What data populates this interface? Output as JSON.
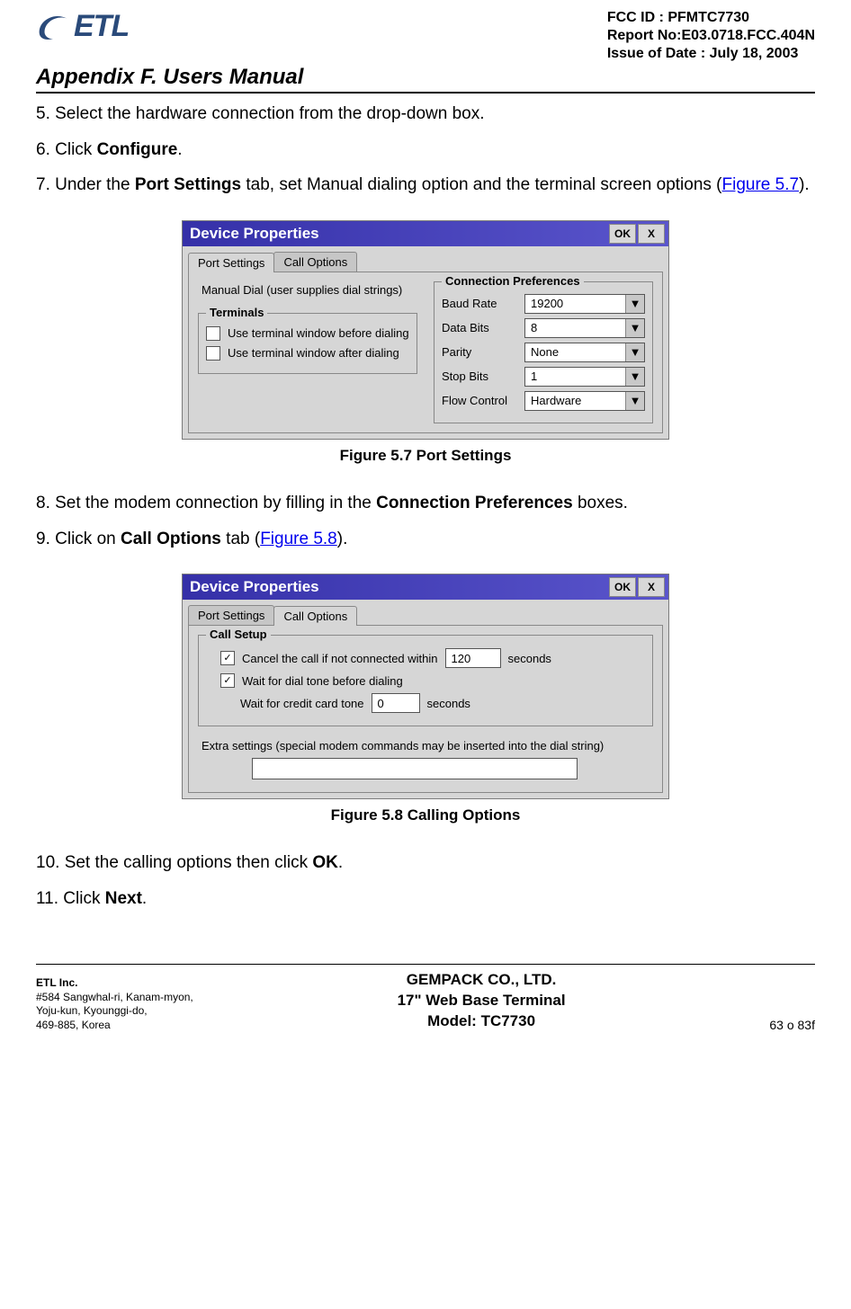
{
  "header": {
    "logo_text": "ETL",
    "fcc_id": "FCC ID : PFMTC7730",
    "report_no": "Report No:E03.0718.FCC.404N",
    "issue_date": "Issue of Date : July 18, 2003"
  },
  "appendix": "Appendix F.  Users Manual",
  "steps": {
    "s5": "5.  Select the hardware connection from the drop-down box.",
    "s6_pre": "6.  Click ",
    "s6_b": "Configure",
    "s6_post": ".",
    "s7_pre": "7.  Under the ",
    "s7_b": "Port Settings",
    "s7_mid": " tab, set Manual dialing option and the terminal screen options (",
    "s7_link": "Figure 5.7",
    "s7_post": ").",
    "s8_pre": "8.  Set the modem connection by filling in the ",
    "s8_b": "Connection Preferences",
    "s8_post": " boxes.",
    "s9_pre": "9.  Click on ",
    "s9_b": "Call Options",
    "s9_mid": " tab (",
    "s9_link": "Figure 5.8",
    "s9_post": ").",
    "s10_pre": "10. Set the calling options then click ",
    "s10_b": "OK",
    "s10_post": ".",
    "s11_pre": "11. Click ",
    "s11_b": "Next",
    "s11_post": "."
  },
  "fig57": {
    "caption": "Figure 5.7    Port Settings",
    "title": "Device Properties",
    "ok": "OK",
    "close": "X",
    "tab1": "Port Settings",
    "tab2": "Call Options",
    "manual_dial": "Manual Dial (user supplies dial strings)",
    "terminals_legend": "Terminals",
    "term_before": "Use terminal window before dialing",
    "term_after": "Use terminal window after dialing",
    "conn_legend": "Connection Preferences",
    "baud_label": "Baud Rate",
    "baud_value": "19200",
    "databits_label": "Data Bits",
    "databits_value": "8",
    "parity_label": "Parity",
    "parity_value": "None",
    "stopbits_label": "Stop Bits",
    "stopbits_value": "1",
    "flow_label": "Flow Control",
    "flow_value": "Hardware"
  },
  "fig58": {
    "caption": "Figure 5.8    Calling Options",
    "title": "Device Properties",
    "ok": "OK",
    "close": "X",
    "tab1": "Port Settings",
    "tab2": "Call Options",
    "call_setup_legend": "Call Setup",
    "cancel_label_pre": "Cancel the call if not connected within",
    "cancel_value": "120",
    "seconds": "seconds",
    "wait_dial": "Wait for dial tone before dialing",
    "wait_credit_pre": "Wait for credit card tone",
    "wait_credit_value": "0",
    "extra_label": "Extra settings (special modem commands may be inserted into the dial string)"
  },
  "footer": {
    "company": "ETL Inc.",
    "addr1": "#584 Sangwhal-ri, Kanam-myon,",
    "addr2": "Yoju-kun, Kyounggi-do,",
    "addr3": "469-885, Korea",
    "center1": "GEMPACK CO., LTD.",
    "center2": "17\" Web Base Terminal",
    "center3": "Model: TC7730",
    "page": "63 o 83f"
  }
}
